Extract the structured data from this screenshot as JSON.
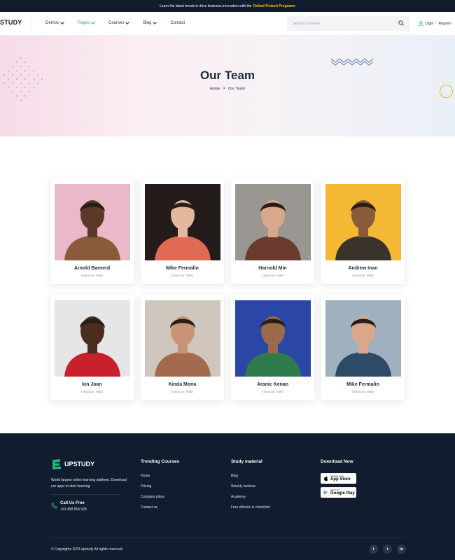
{
  "announcement": {
    "text": "Learn the latest trends in drive business innovation with the",
    "highlight": "Oxford Fintech Programe"
  },
  "header": {
    "logo": "STUDY",
    "nav": [
      {
        "label": "Demos",
        "dropdown": true
      },
      {
        "label": "Pages",
        "dropdown": true,
        "active": true
      },
      {
        "label": "Courses",
        "dropdown": true
      },
      {
        "label": "Blog",
        "dropdown": true
      },
      {
        "label": "Contact",
        "dropdown": false
      }
    ],
    "search_placeholder": "Search Courses",
    "login": "Login",
    "slash": "/",
    "register": "Register"
  },
  "hero": {
    "title": "Our Team",
    "breadcrumb_home": "Home",
    "breadcrumb_sep": ">",
    "breadcrumb_current": "Our Team"
  },
  "team": [
    {
      "name": "Arnold Barnerd",
      "role": "Instructor, Math",
      "bg": "#e9b9c9",
      "shirt": "#8a5a3c",
      "skin": "#5a3a26"
    },
    {
      "name": "Mike Fermalin",
      "role": "Instructor, Math",
      "bg": "#241c1a",
      "shirt": "#e06a55",
      "skin": "#e3b89c"
    },
    {
      "name": "Harnold Min",
      "role": "Instructor, Math",
      "bg": "#9a9691",
      "shirt": "#6a3b2e",
      "skin": "#d9a88a"
    },
    {
      "name": "Andrew Inan",
      "role": "Instructor, Math",
      "bg": "#f4b834",
      "shirt": "#3a332c",
      "skin": "#8a5a3a"
    },
    {
      "name": "kin Joan",
      "role": "Instructor, Math",
      "bg": "#e6e6e6",
      "shirt": "#c9212c",
      "skin": "#4a2d1e"
    },
    {
      "name": "Kinda Mona",
      "role": "Instructor, Math",
      "bg": "#cfc6bd",
      "shirt": "#a36a4e",
      "skin": "#c89477"
    },
    {
      "name": "Aranic Kenan",
      "role": "Instructor, Math",
      "bg": "#2a47a6",
      "shirt": "#2f7a4a",
      "skin": "#9a6a4a"
    },
    {
      "name": "Mike Fermalin",
      "role": "Instructor, Math",
      "bg": "#9fb0bf",
      "shirt": "#2d4a66",
      "skin": "#d9a88a"
    }
  ],
  "footer": {
    "brand": "UPSTUDY",
    "description": "World largest online learning platform. Download our apps to start learning.",
    "call_title": "Call Us Free",
    "call_number": "+91 458 654 528",
    "columns": [
      {
        "title": "Trending Courses",
        "links": [
          "Home",
          "Pricing",
          "Compare plans",
          "Contact us"
        ]
      },
      {
        "title": "Study material",
        "links": [
          "Blog",
          "Weekly webinar",
          "Academy",
          "Free eBooks & checklists"
        ]
      }
    ],
    "download_title": "Download Now",
    "app_store_small": "Download on the",
    "app_store": "App Store",
    "google_play_small": "GET IT ON",
    "google_play": "Google Play",
    "copyright": "© Copyrights 2023 upstudy All rights reserved.",
    "socials": [
      "f",
      "t",
      "in"
    ]
  },
  "colors": {
    "accent": "#1fb57a",
    "dark": "#111c2e",
    "highlight": "#f5c518"
  }
}
